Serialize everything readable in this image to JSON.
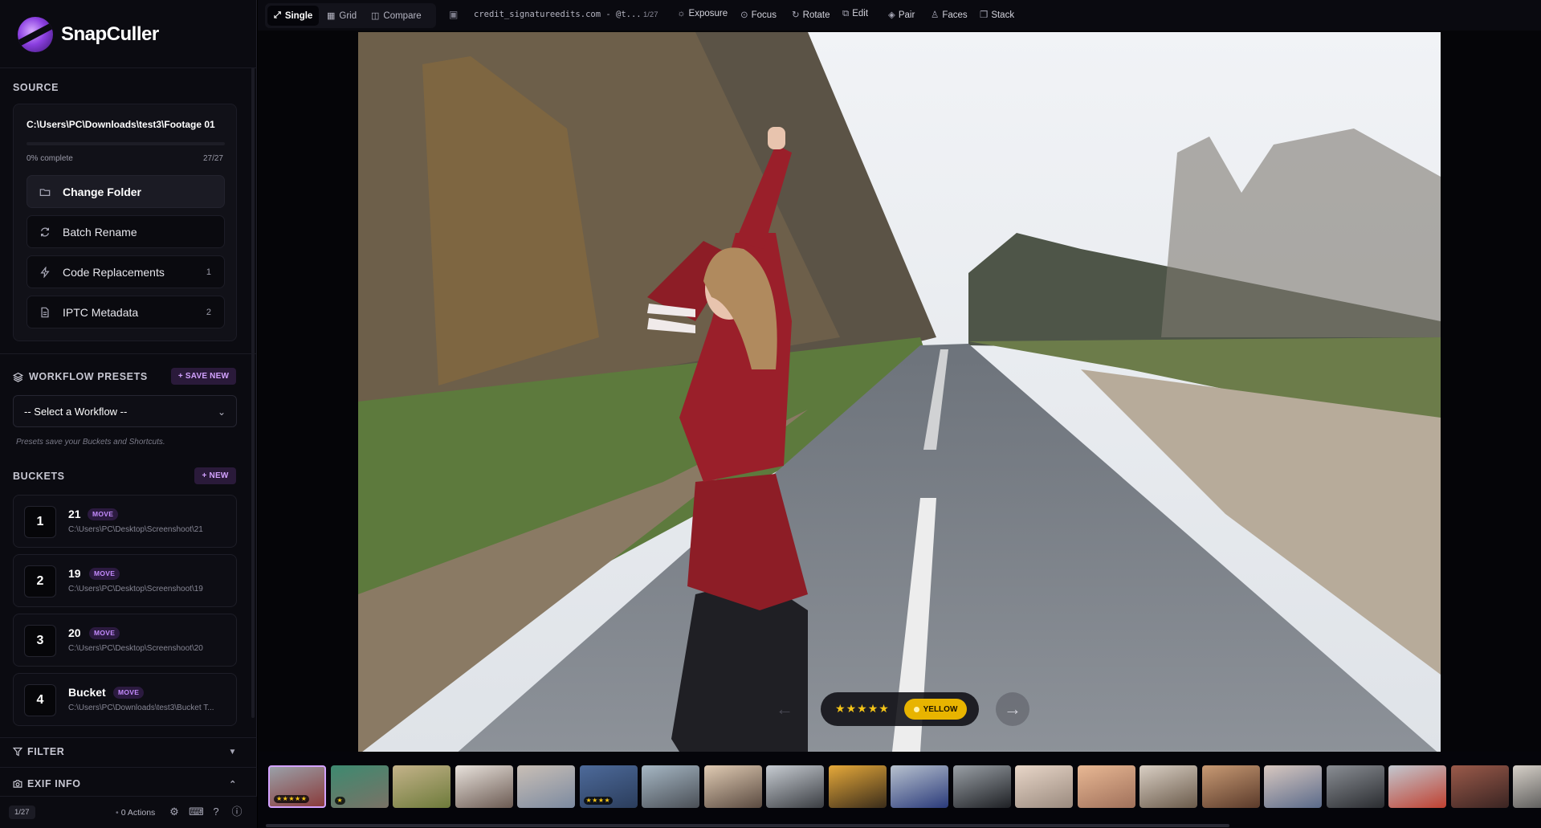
{
  "app": {
    "name": "SnapCuller"
  },
  "sidebar": {
    "source": {
      "title": "SOURCE",
      "path": "C:\\Users\\PC\\Downloads\\test3\\Footage 01",
      "progress_label": "0% complete",
      "progress_fraction": 0,
      "count": "27/27",
      "buttons": [
        {
          "label": "Change Folder",
          "icon": "folder-icon",
          "count": ""
        },
        {
          "label": "Batch Rename",
          "icon": "refresh-icon",
          "count": ""
        },
        {
          "label": "Code Replacements",
          "icon": "bolt-icon",
          "count": "1"
        },
        {
          "label": "IPTC Metadata",
          "icon": "document-icon",
          "count": "2"
        }
      ]
    },
    "workflow": {
      "title": "WORKFLOW PRESETS",
      "save_label": "+ SAVE NEW",
      "select_value": "-- Select a Workflow --",
      "note": "Presets save your Buckets and Shortcuts."
    },
    "buckets": {
      "title": "BUCKETS",
      "new_label": "+ NEW",
      "items": [
        {
          "num": "1",
          "name": "21",
          "tag": "MOVE",
          "path": "C:\\Users\\PC\\Desktop\\Screenshoot\\21"
        },
        {
          "num": "2",
          "name": "19",
          "tag": "MOVE",
          "path": "C:\\Users\\PC\\Desktop\\Screenshoot\\19"
        },
        {
          "num": "3",
          "name": "20",
          "tag": "MOVE",
          "path": "C:\\Users\\PC\\Desktop\\Screenshoot\\20"
        },
        {
          "num": "4",
          "name": "Bucket",
          "tag": "MOVE",
          "path": "C:\\Users\\PC\\Downloads\\test3\\Bucket T..."
        }
      ]
    },
    "filter": {
      "title": "FILTER"
    },
    "exif": {
      "title": "EXIF INFO"
    },
    "footer": {
      "page": "1/27",
      "actions": "0 Actions"
    }
  },
  "toolbar": {
    "views": [
      {
        "label": "Single",
        "icon": "expand-icon",
        "active": true
      },
      {
        "label": "Grid",
        "icon": "grid-icon",
        "active": false
      },
      {
        "label": "Compare",
        "icon": "compare-icon",
        "active": false
      }
    ],
    "filename": "credit_signatureedits.com - @t...",
    "file_count": "1/27",
    "tools": [
      {
        "label": "Exposure",
        "icon": "sun-icon"
      },
      {
        "label": "Focus",
        "icon": "focus-icon"
      },
      {
        "label": "Rotate",
        "icon": "rotate-icon"
      },
      {
        "label": "Edit",
        "icon": "external-edit-icon"
      },
      {
        "label": "Pair",
        "icon": "layers-icon"
      },
      {
        "label": "Faces",
        "icon": "person-icon"
      },
      {
        "label": "Stack",
        "icon": "stack-icon"
      }
    ]
  },
  "viewer": {
    "rating": 5,
    "rating_max": 5,
    "color_label": "YELLOW",
    "color_hex": "#e8b400"
  },
  "filmstrip": {
    "thumbnails": [
      {
        "stars": "★★★★★",
        "c1": "#9aa0a8",
        "c2": "#8a3b3b",
        "selected": true
      },
      {
        "stars": "★",
        "c1": "#3d8a70",
        "c2": "#7a7266",
        "selected": false
      },
      {
        "stars": "",
        "c1": "#c4b38a",
        "c2": "#6d7a3a",
        "selected": false
      },
      {
        "stars": "",
        "c1": "#e8e2dc",
        "c2": "#6b5a52",
        "selected": false
      },
      {
        "stars": "",
        "c1": "#c9bfb6",
        "c2": "#7c8aa0",
        "selected": false
      },
      {
        "stars": "★★★★",
        "c1": "#4d6a9a",
        "c2": "#2b3d5c",
        "selected": false
      },
      {
        "stars": "",
        "c1": "#a6b7c4",
        "c2": "#4a4f56",
        "selected": false
      },
      {
        "stars": "",
        "c1": "#e0cbb3",
        "c2": "#5a4a40",
        "selected": false
      },
      {
        "stars": "",
        "c1": "#c7ccd2",
        "c2": "#3a3d42",
        "selected": false
      },
      {
        "stars": "",
        "c1": "#e6a93a",
        "c2": "#3a2c1a",
        "selected": false
      },
      {
        "stars": "",
        "c1": "#b8c2cf",
        "c2": "#2a3a7a",
        "selected": false
      },
      {
        "stars": "",
        "c1": "#9aa0a6",
        "c2": "#1e2024",
        "selected": false
      },
      {
        "stars": "",
        "c1": "#e8d6c8",
        "c2": "#9a8a7e",
        "selected": false
      },
      {
        "stars": "",
        "c1": "#e8b894",
        "c2": "#a0705a",
        "selected": false
      },
      {
        "stars": "",
        "c1": "#d9cfc4",
        "c2": "#6a5a4a",
        "selected": false
      },
      {
        "stars": "",
        "c1": "#c89a74",
        "c2": "#5a3a2a",
        "selected": false
      },
      {
        "stars": "",
        "c1": "#d8c8c0",
        "c2": "#5a6a8a",
        "selected": false
      },
      {
        "stars": "",
        "c1": "#8a8e94",
        "c2": "#2a2c30",
        "selected": false
      },
      {
        "stars": "",
        "c1": "#c2c8d0",
        "c2": "#c04030",
        "selected": false
      },
      {
        "stars": "",
        "c1": "#9a5a4a",
        "c2": "#3a2422",
        "selected": false
      },
      {
        "stars": "",
        "c1": "#d6d0c8",
        "c2": "#4a4a4a",
        "selected": false
      }
    ]
  }
}
